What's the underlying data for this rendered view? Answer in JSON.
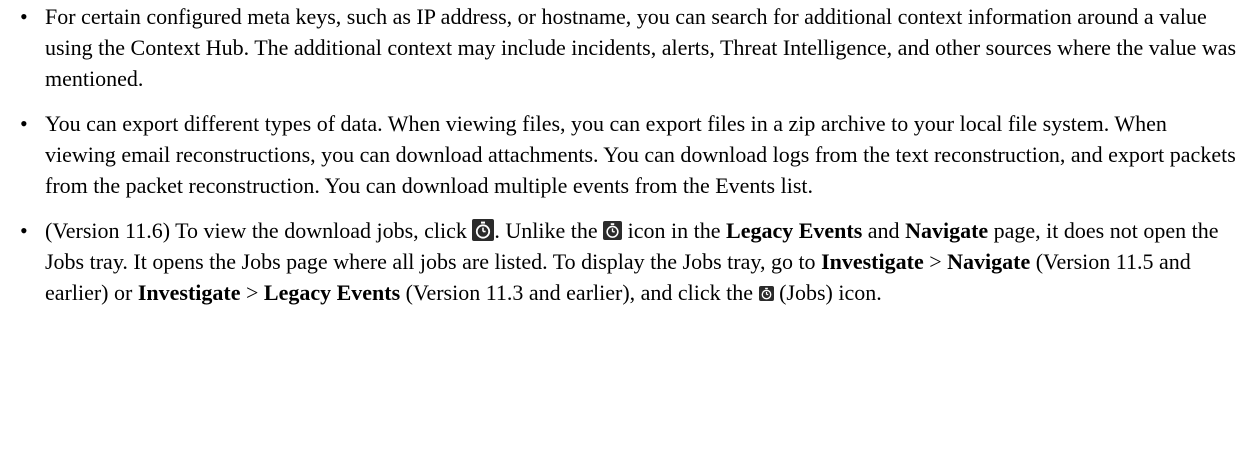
{
  "bullets": [
    {
      "text": "For certain configured meta keys, such as IP address, or hostname, you can search for additional context information around a value using the Context Hub. The additional context may include incidents, alerts, Threat Intelligence, and other sources where the value was mentioned."
    },
    {
      "text": "You can export different types of data. When viewing files, you can export files in a zip archive to your local file system. When viewing email reconstructions, you can download attachments. You can download logs from the text reconstruction, and export packets from the packet reconstruction. You can download multiple events from the Events list."
    },
    {
      "seg1": "(Version 11.6) To view the download jobs, click ",
      "seg2": ". Unlike the ",
      "seg3": " icon in the ",
      "legacy_events": "Legacy Events",
      "seg4": " and ",
      "navigate": "Navigate",
      "seg5": " page, it does not open the Jobs tray. It opens the Jobs page where all jobs are listed. To display the Jobs tray, go to ",
      "investigate1": "Investigate",
      "seg6": " > ",
      "navigate2": "Navigate",
      "seg7": " (Version 11.5 and earlier) or ",
      "investigate2": "Investigate",
      "seg8": " > ",
      "legacy_events2": "Legacy Events",
      "seg9": " (Version 11.3 and earlier), and click the ",
      "seg10": " (Jobs) icon."
    }
  ],
  "bullet_glyph": "•",
  "icons": {
    "jobs": "stopwatch-icon"
  }
}
